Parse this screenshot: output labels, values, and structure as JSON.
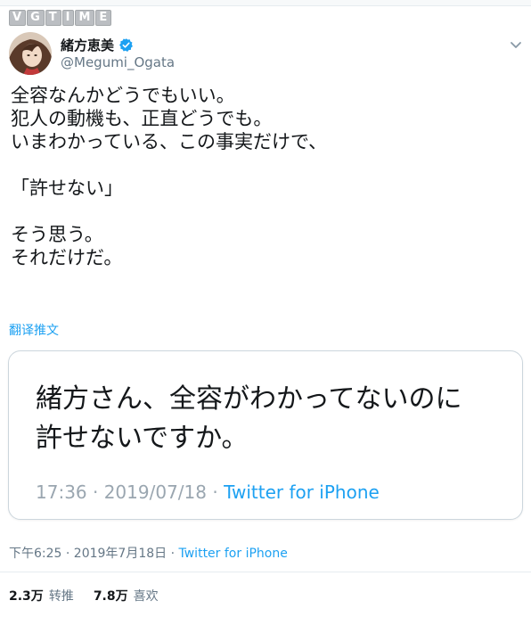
{
  "watermark": {
    "letters": [
      "V",
      "G",
      "T",
      "I",
      "M",
      "E"
    ]
  },
  "author": {
    "display_name": "緒方恵美",
    "handle": "@Megumi_Ogata",
    "verified": true
  },
  "tweet": {
    "lines": [
      "全容なんかどうでもいい。",
      "犯人の動機も、正直どうでも。",
      "いまわかっている、この事実だけで、",
      "",
      "「許せない」",
      "",
      "そう思う。",
      "それだけだ。"
    ],
    "translate_label": "翻译推文"
  },
  "quoted_card": {
    "line1": "緒方さん、全容がわかってないのに",
    "line2": "許せないですか。",
    "timestamp": "17:36 · 2019/07/18 · ",
    "source": "Twitter for iPhone"
  },
  "meta": {
    "timestamp": "下午6:25 · 2019年7月18日 · ",
    "source": "Twitter for iPhone"
  },
  "stats": {
    "retweets_count": "2.3万",
    "retweets_label": "转推",
    "likes_count": "7.8万",
    "likes_label": "喜欢"
  },
  "colors": {
    "accent": "#1da1f2",
    "text": "#14171a",
    "muted": "#657786",
    "border": "#e6ecf0"
  },
  "icons": {
    "verified": "verified-badge-icon",
    "menu": "chevron-down-icon"
  }
}
